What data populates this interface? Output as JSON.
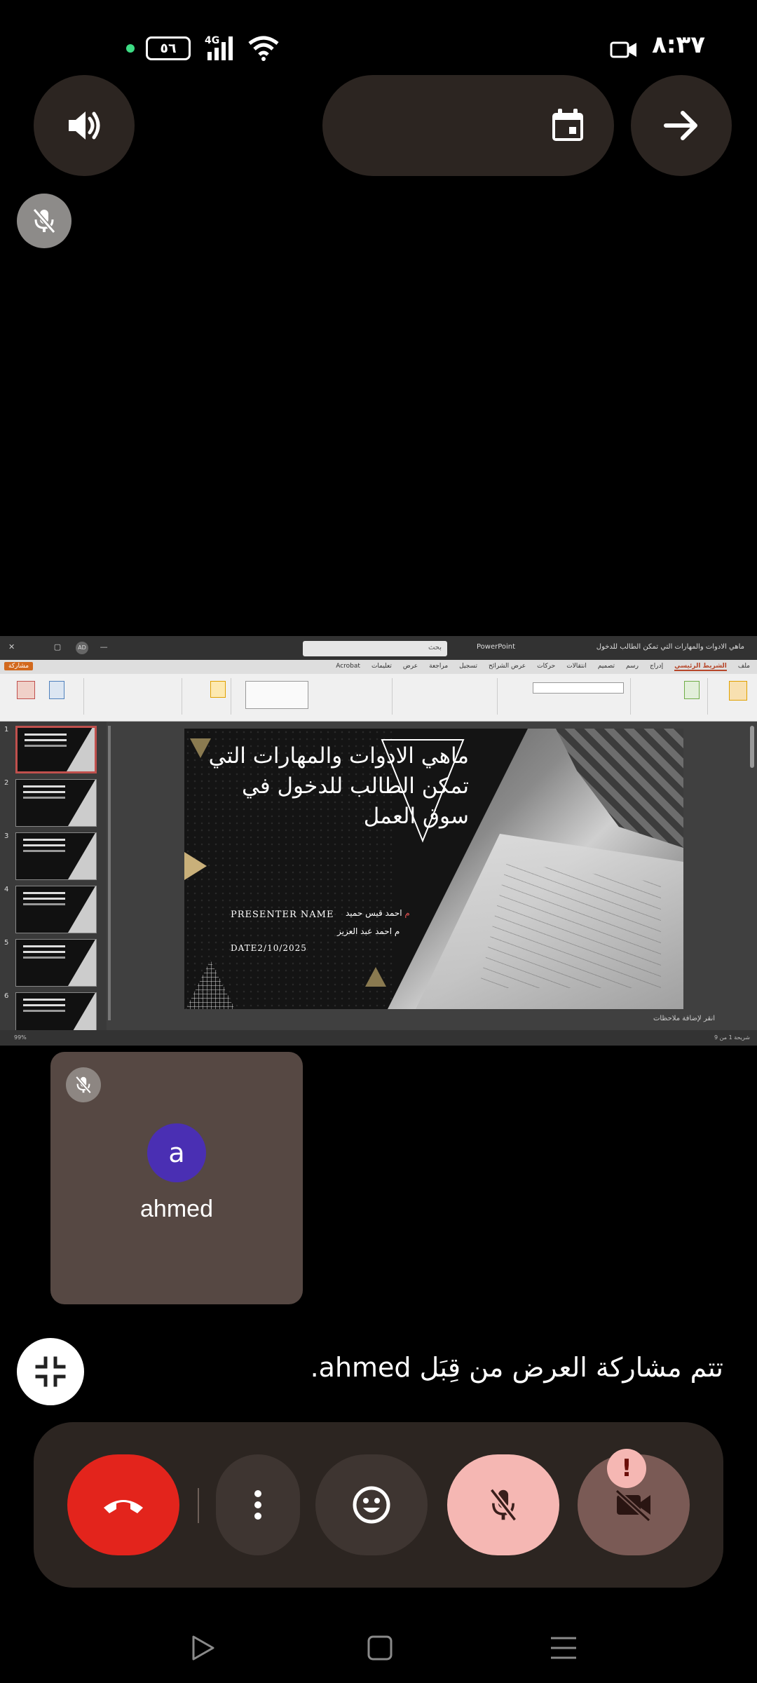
{
  "status_bar": {
    "time": "٨:٣٧",
    "battery": "٥٦",
    "network": "4G",
    "icons": [
      "green-dot",
      "battery-icon",
      "signal-icon",
      "wifi-icon",
      "camera-icon"
    ]
  },
  "top_controls": {
    "speaker_icon": "volume-icon",
    "calendar_icon": "calendar-icon",
    "forward_icon": "arrow-right-icon",
    "muted_icon": "mic-off-icon"
  },
  "presentation": {
    "window_title": "ماهي الادوات والمهارات التي تمكن الطالب للدخول",
    "app_name": "PowerPoint",
    "search_placeholder": "بحث",
    "avatar_initials": "AD",
    "share_label": "مشاركة",
    "tabs": [
      "ملف",
      "الشريط الرئيسي",
      "إدراج",
      "رسم",
      "تصميم",
      "انتقالات",
      "حركات",
      "عرض الشرائح",
      "تسجيل",
      "مراجعة",
      "عرض",
      "تعليمات",
      "Acrobat"
    ],
    "active_tab": "الشريط الرئيسي",
    "slide_numbers": [
      "1",
      "2",
      "3",
      "4",
      "5",
      "6"
    ],
    "slide": {
      "headline": "ماهي الادوات والمهارات التي تمكن الطالب للدخول في سوق العمل",
      "presenter_label": "PRESENTER NAME",
      "presenter_prefix": "م",
      "presenter_name": "احمد قيس حميد",
      "supervisor": "م احمد عبد العزيز",
      "date": "DATE2/10/2025"
    },
    "notes_placeholder": "انقر لإضافة ملاحظات",
    "status_info": "شريحة 1 من 9",
    "zoom": "99%"
  },
  "participant": {
    "initial": "a",
    "name": "ahmed",
    "mic_icon": "mic-off-icon"
  },
  "sharing_banner": {
    "text": "تتم مشاركة العرض من قِبَل ahmed.",
    "stop_icon": "stop-share-icon"
  },
  "call_bar": {
    "end_call_icon": "phone-hangup-icon",
    "more_icon": "more-vert-icon",
    "emoji_icon": "emoji-icon",
    "mic_icon": "mic-off-icon",
    "camera_icon": "videocam-off-icon",
    "alert_badge": "!",
    "colors": {
      "end": "#e3241c",
      "mic": "#f5b7b3",
      "camera": "#7a5a55"
    }
  },
  "nav_bar": {
    "icons": [
      "play-icon",
      "home-square-icon",
      "menu-lines-icon"
    ]
  }
}
